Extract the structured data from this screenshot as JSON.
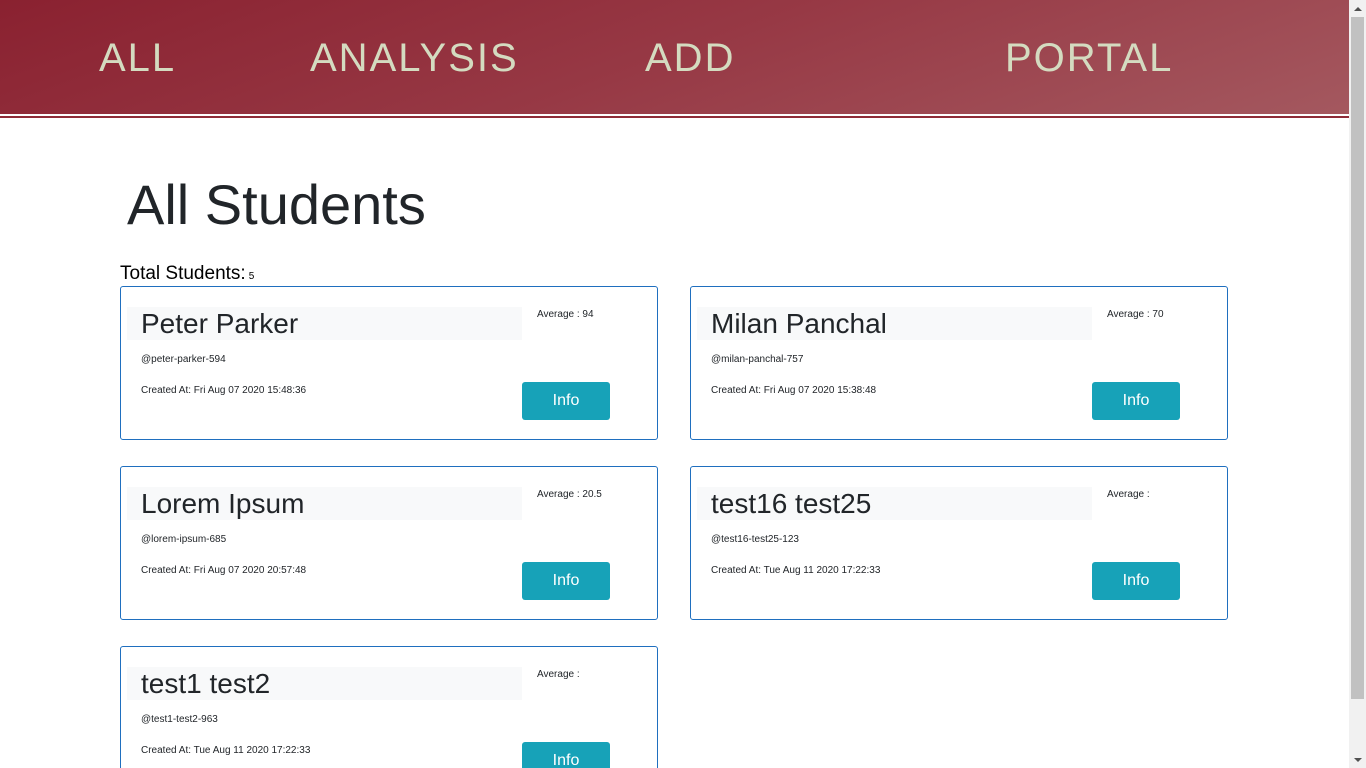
{
  "nav": {
    "all": "ALL",
    "analysis": "ANALYSIS",
    "add": "ADD",
    "portal": "PORTAL"
  },
  "main": {
    "title": "All Students",
    "total_label": "Total Students:",
    "total_count": "5"
  },
  "students": [
    {
      "name": "Peter Parker",
      "average": "Average : 94",
      "handle": "@peter-parker-594",
      "created": "Created At: Fri Aug 07 2020 15:48:36",
      "button": "Info"
    },
    {
      "name": "Milan Panchal",
      "average": "Average : 70",
      "handle": "@milan-panchal-757",
      "created": "Created At: Fri Aug 07 2020 15:38:48",
      "button": "Info"
    },
    {
      "name": "Lorem Ipsum",
      "average": "Average : 20.5",
      "handle": "@lorem-ipsum-685",
      "created": "Created At: Fri Aug 07 2020 20:57:48",
      "button": "Info"
    },
    {
      "name": "test16 test25",
      "average": "Average :",
      "handle": "@test16-test25-123",
      "created": "Created At: Tue Aug 11 2020 17:22:33",
      "button": "Info"
    },
    {
      "name": "test1 test2",
      "average": "Average :",
      "handle": "@test1-test2-963",
      "created": "Created At: Tue Aug 11 2020 17:22:33",
      "button": "Info"
    }
  ],
  "colors": {
    "header": "#8a2130",
    "nav_text": "#d4dbc0",
    "card_border": "#1f6fbf",
    "info_button": "#17a2b8"
  }
}
